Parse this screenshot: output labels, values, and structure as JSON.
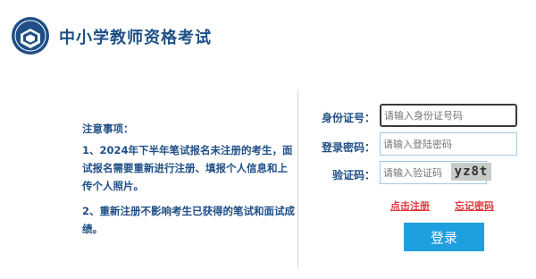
{
  "header": {
    "title": "中小学教师资格考试"
  },
  "notice": {
    "title": "注意事项：",
    "items": [
      "1、2024年下半年笔试报名未注册的考生，面试报名需要重新进行注册、填报个人信息和上传个人照片。",
      "2、重新注册不影响考生已获得的笔试和面试成绩。"
    ]
  },
  "login_form": {
    "id_label": "身份证号：",
    "id_placeholder": "请输入身份证号码",
    "password_label": "登录密码：",
    "password_placeholder": "请输入登陆密码",
    "captcha_label": "验证码：",
    "captcha_placeholder": "请输入验证码",
    "captcha_text": "yz8t",
    "register_link": "点击注册",
    "forgot_link": "忘记密码",
    "login_button": "登录"
  },
  "colors": {
    "brand": "#1f4f86",
    "button": "#1e9fe0",
    "link": "#e0383e"
  },
  "icons": [
    "site-logo-icon"
  ]
}
